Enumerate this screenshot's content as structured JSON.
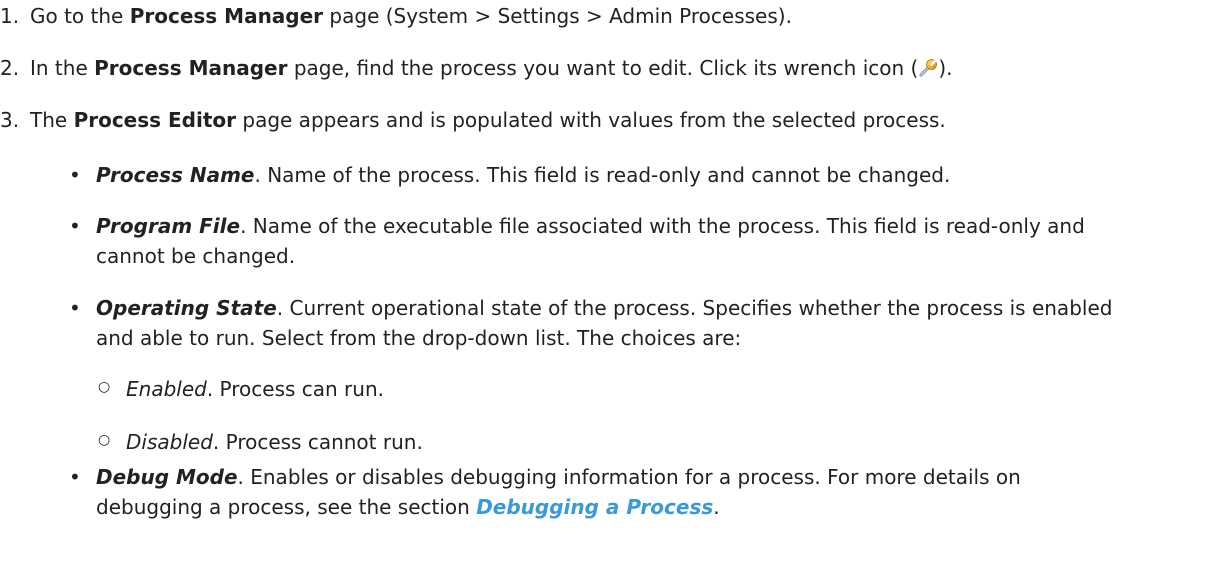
{
  "steps": [
    {
      "num": "1.",
      "pre": "Go to the ",
      "term": "Process Manager",
      "post": " page (System > Settings > Admin Processes)."
    },
    {
      "num": "2.",
      "pre": "In the ",
      "term": "Process Manager",
      "mid": " page, find the process you want to edit. Click its wrench icon (",
      "post": ")."
    },
    {
      "num": "3.",
      "pre": "The ",
      "term": "Process Editor",
      "post": " page appears and is populated with values from the selected process."
    }
  ],
  "fields": [
    {
      "name": "Process Name",
      "desc": ". Name of the process. This field is read-only and cannot be changed."
    },
    {
      "name": "Program File",
      "desc_line1": ". Name of the executable file associated with the process. This field is read-only and",
      "desc_line2": "cannot be changed."
    },
    {
      "name": "Operating State",
      "desc_line1": ". Current operational state of the process. Specifies whether the process is enabled",
      "desc_line2": "and able to run. Select from the drop-down list. The choices are:",
      "options": [
        {
          "name": "Enabled",
          "desc": ". Process can run."
        },
        {
          "name": "Disabled",
          "desc": ". Process cannot run."
        }
      ]
    },
    {
      "name": "Debug Mode",
      "desc_line1": ". Enables or disables debugging information for a process. For more details on",
      "desc_line2_pre": "debugging a process, see the section ",
      "link": "Debugging a Process",
      "desc_line2_post": "."
    }
  ],
  "icons": {
    "wrench": "wrench-icon"
  },
  "colors": {
    "link": "#3a9ad9",
    "text": "#222222"
  }
}
